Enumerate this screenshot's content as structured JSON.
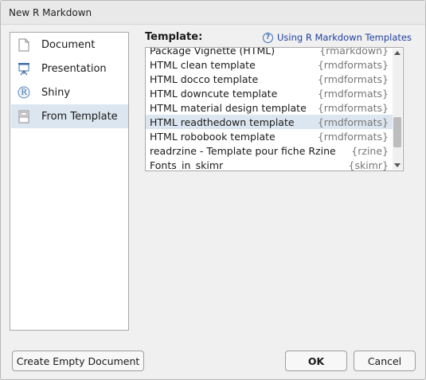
{
  "window": {
    "title": "New R Markdown"
  },
  "sidebar": {
    "items": [
      {
        "label": "Document",
        "icon": "document-icon",
        "selected": false
      },
      {
        "label": "Presentation",
        "icon": "presentation-icon",
        "selected": false
      },
      {
        "label": "Shiny",
        "icon": "shiny-icon",
        "icon_glyph": "R",
        "selected": false
      },
      {
        "label": "From Template",
        "icon": "template-icon",
        "selected": true
      }
    ]
  },
  "template": {
    "label": "Template:",
    "help_link": "Using R Markdown Templates",
    "help_icon_glyph": "?",
    "rows": [
      {
        "name": "Package Vignette (HTML)",
        "package": "{rmarkdown}",
        "selected": false
      },
      {
        "name": "HTML clean template",
        "package": "{rmdformats}",
        "selected": false
      },
      {
        "name": "HTML docco template",
        "package": "{rmdformats}",
        "selected": false
      },
      {
        "name": "HTML downcute template",
        "package": "{rmdformats}",
        "selected": false
      },
      {
        "name": "HTML material design template",
        "package": "{rmdformats}",
        "selected": false
      },
      {
        "name": "HTML readthedown template",
        "package": "{rmdformats}",
        "selected": true
      },
      {
        "name": "HTML robobook template",
        "package": "{rmdformats}",
        "selected": false
      },
      {
        "name": "readrzine - Template pour fiche Rzine",
        "package": "{rzine}",
        "selected": false
      },
      {
        "name": "Fonts_in_skimr",
        "package": "{skimr}",
        "selected": false
      }
    ]
  },
  "buttons": {
    "create_empty": "Create Empty Document",
    "ok": "OK",
    "cancel": "Cancel"
  },
  "colors": {
    "selection": "#dce6f0",
    "link": "#1f3fa0",
    "package_text": "#777777"
  }
}
